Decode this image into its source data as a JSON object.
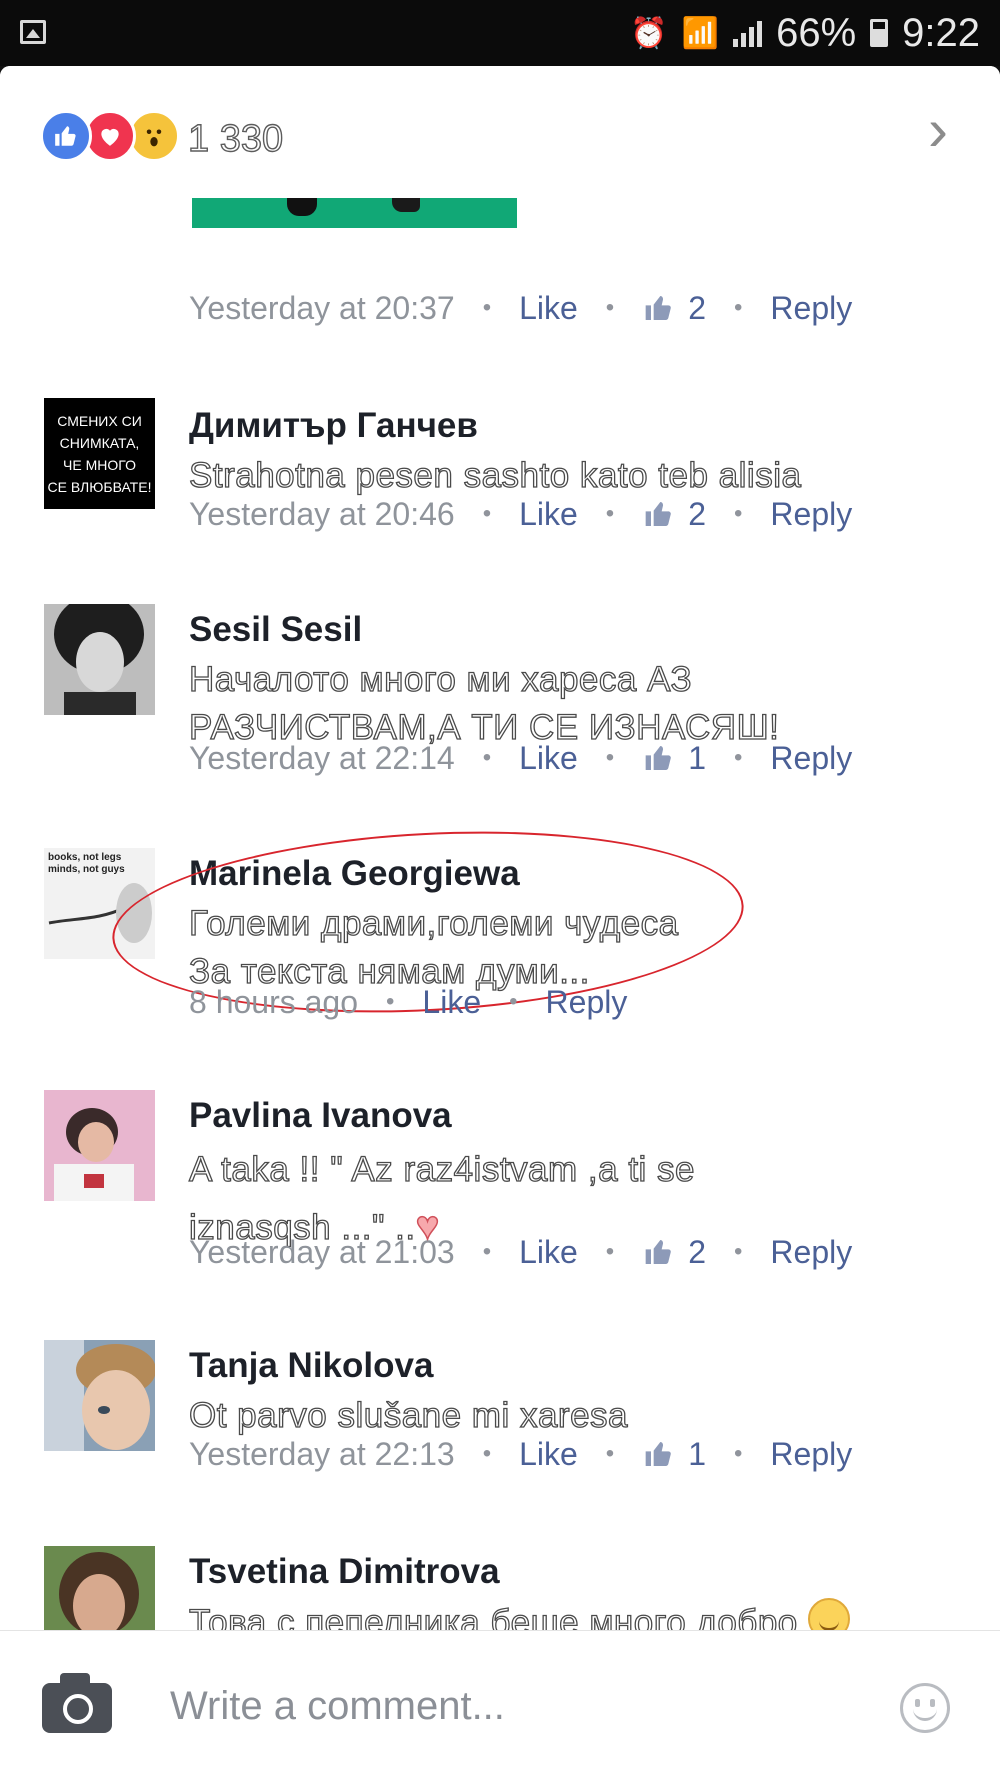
{
  "status_bar": {
    "battery": "66%",
    "time": "9:22",
    "icons": [
      "gallery-icon",
      "alarm-icon",
      "wifi-icon",
      "signal-icon",
      "battery-icon"
    ]
  },
  "reactions": {
    "types": [
      "like",
      "love",
      "wow"
    ],
    "count": "1 330"
  },
  "first_comment_meta": {
    "time": "Yesterday at 20:37",
    "like": "Like",
    "likes": "2",
    "reply": "Reply"
  },
  "comments": [
    {
      "author": "Димитър Ганчев",
      "avatar_text": [
        "СМЕНИХ СИ",
        "СНИМКАТА,",
        "ЧЕ МНОГО",
        "СЕ ВЛЮБВАТЕ!"
      ],
      "text": "Strahotna pesen sashto kato teb alisia",
      "time": "Yesterday at 20:46",
      "like": "Like",
      "likes": "2",
      "reply": "Reply"
    },
    {
      "author": "Sesil Sesil",
      "text": "Началото много ми хареса АЗ РАЗЧИСТВАМ,А ТИ СЕ ИЗНАСЯШ!",
      "time": "Yesterday at 22:14",
      "like": "Like",
      "likes": "1",
      "reply": "Reply"
    },
    {
      "author": "Marinela Georgiewa",
      "avatar_text": [
        "books, not legs",
        "minds, not guys"
      ],
      "text_line1": "Големи драми,големи чудеса",
      "text_line2": "За текста нямам думи...",
      "time": "8 hours ago",
      "like": "Like",
      "reply": "Reply"
    },
    {
      "author": "Pavlina Ivanova",
      "text": "A taka !! \" Az raz4istvam ,a ti se iznasqsh ...\" ..",
      "time": "Yesterday at 21:03",
      "like": "Like",
      "likes": "2",
      "reply": "Reply"
    },
    {
      "author": "Tanja Nikolova",
      "text": "Ot parvo slušane mi xaresa",
      "time": "Yesterday at 22:13",
      "like": "Like",
      "likes": "1",
      "reply": "Reply"
    },
    {
      "author": "Tsvetina Dimitrova",
      "text": "Това с пепелника беше много добро"
    }
  ],
  "composer": {
    "placeholder": "Write a comment..."
  },
  "colors": {
    "link": "#4b6096",
    "like_reaction": "#4a7fe8",
    "love_reaction": "#f0344f",
    "wow_reaction": "#f5c33b",
    "highlight": "#d8252d"
  }
}
